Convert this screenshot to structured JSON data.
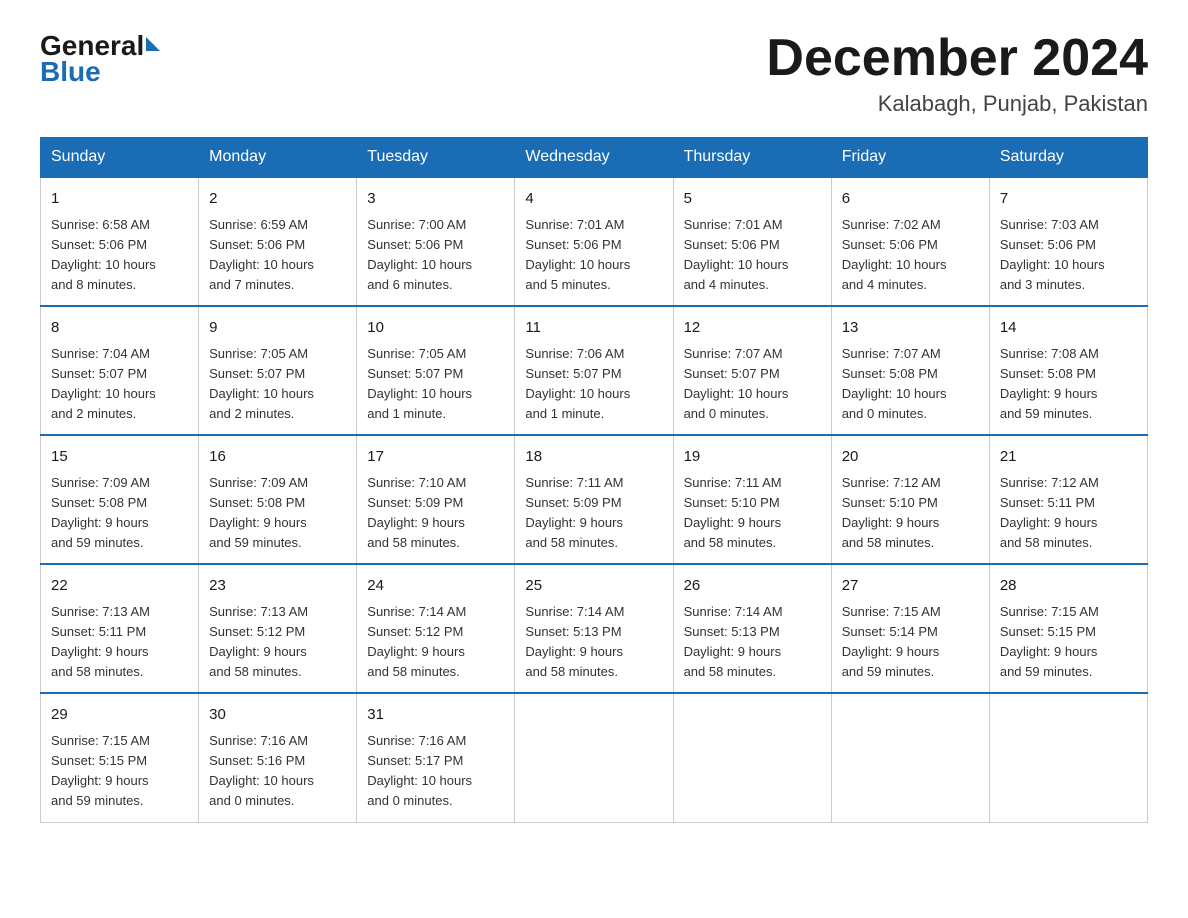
{
  "header": {
    "logo_general": "General",
    "logo_blue": "Blue",
    "month_title": "December 2024",
    "location": "Kalabagh, Punjab, Pakistan"
  },
  "days_of_week": [
    "Sunday",
    "Monday",
    "Tuesday",
    "Wednesday",
    "Thursday",
    "Friday",
    "Saturday"
  ],
  "weeks": [
    [
      {
        "day": "1",
        "info": "Sunrise: 6:58 AM\nSunset: 5:06 PM\nDaylight: 10 hours\nand 8 minutes."
      },
      {
        "day": "2",
        "info": "Sunrise: 6:59 AM\nSunset: 5:06 PM\nDaylight: 10 hours\nand 7 minutes."
      },
      {
        "day": "3",
        "info": "Sunrise: 7:00 AM\nSunset: 5:06 PM\nDaylight: 10 hours\nand 6 minutes."
      },
      {
        "day": "4",
        "info": "Sunrise: 7:01 AM\nSunset: 5:06 PM\nDaylight: 10 hours\nand 5 minutes."
      },
      {
        "day": "5",
        "info": "Sunrise: 7:01 AM\nSunset: 5:06 PM\nDaylight: 10 hours\nand 4 minutes."
      },
      {
        "day": "6",
        "info": "Sunrise: 7:02 AM\nSunset: 5:06 PM\nDaylight: 10 hours\nand 4 minutes."
      },
      {
        "day": "7",
        "info": "Sunrise: 7:03 AM\nSunset: 5:06 PM\nDaylight: 10 hours\nand 3 minutes."
      }
    ],
    [
      {
        "day": "8",
        "info": "Sunrise: 7:04 AM\nSunset: 5:07 PM\nDaylight: 10 hours\nand 2 minutes."
      },
      {
        "day": "9",
        "info": "Sunrise: 7:05 AM\nSunset: 5:07 PM\nDaylight: 10 hours\nand 2 minutes."
      },
      {
        "day": "10",
        "info": "Sunrise: 7:05 AM\nSunset: 5:07 PM\nDaylight: 10 hours\nand 1 minute."
      },
      {
        "day": "11",
        "info": "Sunrise: 7:06 AM\nSunset: 5:07 PM\nDaylight: 10 hours\nand 1 minute."
      },
      {
        "day": "12",
        "info": "Sunrise: 7:07 AM\nSunset: 5:07 PM\nDaylight: 10 hours\nand 0 minutes."
      },
      {
        "day": "13",
        "info": "Sunrise: 7:07 AM\nSunset: 5:08 PM\nDaylight: 10 hours\nand 0 minutes."
      },
      {
        "day": "14",
        "info": "Sunrise: 7:08 AM\nSunset: 5:08 PM\nDaylight: 9 hours\nand 59 minutes."
      }
    ],
    [
      {
        "day": "15",
        "info": "Sunrise: 7:09 AM\nSunset: 5:08 PM\nDaylight: 9 hours\nand 59 minutes."
      },
      {
        "day": "16",
        "info": "Sunrise: 7:09 AM\nSunset: 5:08 PM\nDaylight: 9 hours\nand 59 minutes."
      },
      {
        "day": "17",
        "info": "Sunrise: 7:10 AM\nSunset: 5:09 PM\nDaylight: 9 hours\nand 58 minutes."
      },
      {
        "day": "18",
        "info": "Sunrise: 7:11 AM\nSunset: 5:09 PM\nDaylight: 9 hours\nand 58 minutes."
      },
      {
        "day": "19",
        "info": "Sunrise: 7:11 AM\nSunset: 5:10 PM\nDaylight: 9 hours\nand 58 minutes."
      },
      {
        "day": "20",
        "info": "Sunrise: 7:12 AM\nSunset: 5:10 PM\nDaylight: 9 hours\nand 58 minutes."
      },
      {
        "day": "21",
        "info": "Sunrise: 7:12 AM\nSunset: 5:11 PM\nDaylight: 9 hours\nand 58 minutes."
      }
    ],
    [
      {
        "day": "22",
        "info": "Sunrise: 7:13 AM\nSunset: 5:11 PM\nDaylight: 9 hours\nand 58 minutes."
      },
      {
        "day": "23",
        "info": "Sunrise: 7:13 AM\nSunset: 5:12 PM\nDaylight: 9 hours\nand 58 minutes."
      },
      {
        "day": "24",
        "info": "Sunrise: 7:14 AM\nSunset: 5:12 PM\nDaylight: 9 hours\nand 58 minutes."
      },
      {
        "day": "25",
        "info": "Sunrise: 7:14 AM\nSunset: 5:13 PM\nDaylight: 9 hours\nand 58 minutes."
      },
      {
        "day": "26",
        "info": "Sunrise: 7:14 AM\nSunset: 5:13 PM\nDaylight: 9 hours\nand 58 minutes."
      },
      {
        "day": "27",
        "info": "Sunrise: 7:15 AM\nSunset: 5:14 PM\nDaylight: 9 hours\nand 59 minutes."
      },
      {
        "day": "28",
        "info": "Sunrise: 7:15 AM\nSunset: 5:15 PM\nDaylight: 9 hours\nand 59 minutes."
      }
    ],
    [
      {
        "day": "29",
        "info": "Sunrise: 7:15 AM\nSunset: 5:15 PM\nDaylight: 9 hours\nand 59 minutes."
      },
      {
        "day": "30",
        "info": "Sunrise: 7:16 AM\nSunset: 5:16 PM\nDaylight: 10 hours\nand 0 minutes."
      },
      {
        "day": "31",
        "info": "Sunrise: 7:16 AM\nSunset: 5:17 PM\nDaylight: 10 hours\nand 0 minutes."
      },
      {
        "day": "",
        "info": ""
      },
      {
        "day": "",
        "info": ""
      },
      {
        "day": "",
        "info": ""
      },
      {
        "day": "",
        "info": ""
      }
    ]
  ]
}
